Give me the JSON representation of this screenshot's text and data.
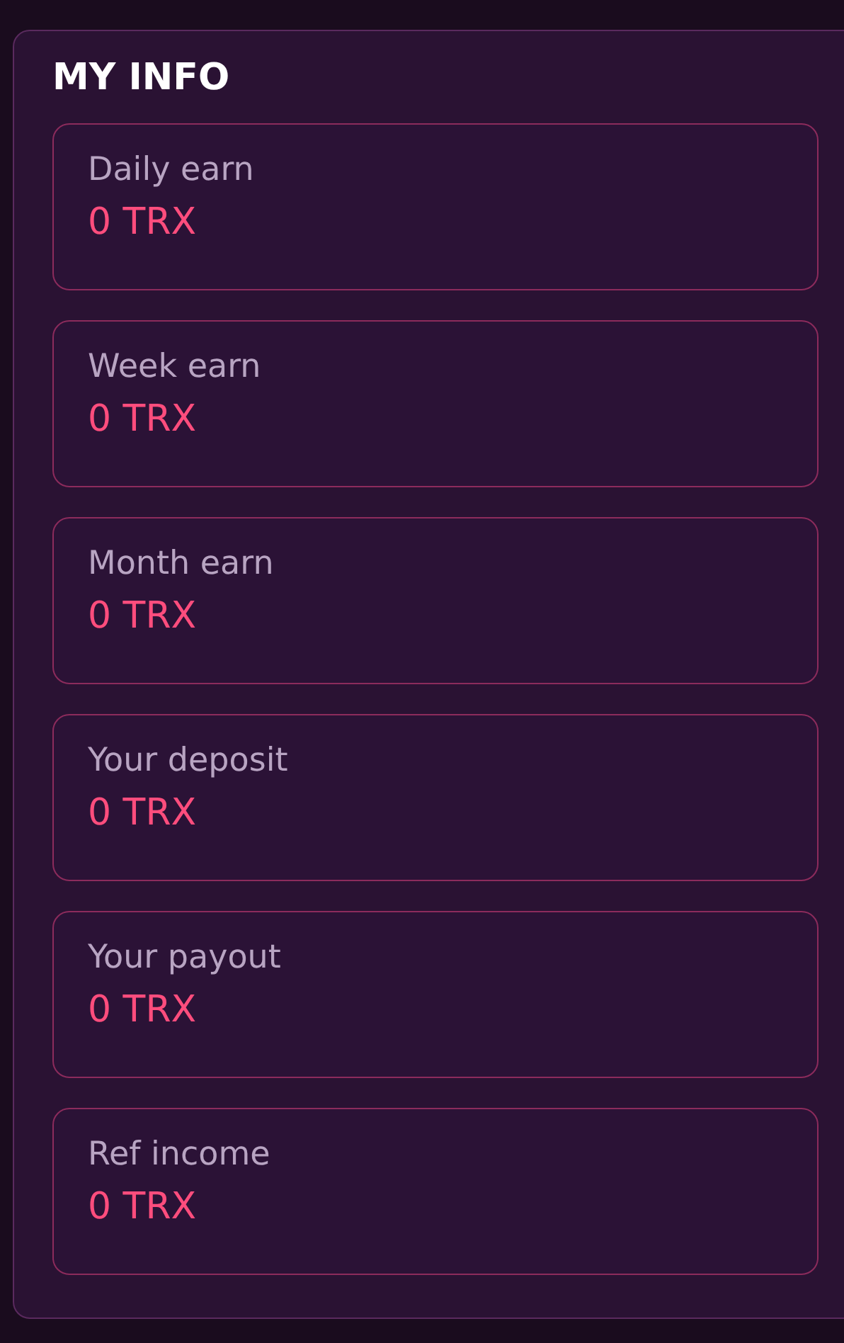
{
  "panel": {
    "title": "MY INFO",
    "cards": [
      {
        "label": "Daily earn",
        "value": "0 TRX"
      },
      {
        "label": "Week earn",
        "value": "0 TRX"
      },
      {
        "label": "Month earn",
        "value": "0 TRX"
      },
      {
        "label": "Your deposit",
        "value": "0 TRX"
      },
      {
        "label": "Your payout",
        "value": "0 TRX"
      },
      {
        "label": "Ref income",
        "value": "0 TRX"
      }
    ]
  }
}
